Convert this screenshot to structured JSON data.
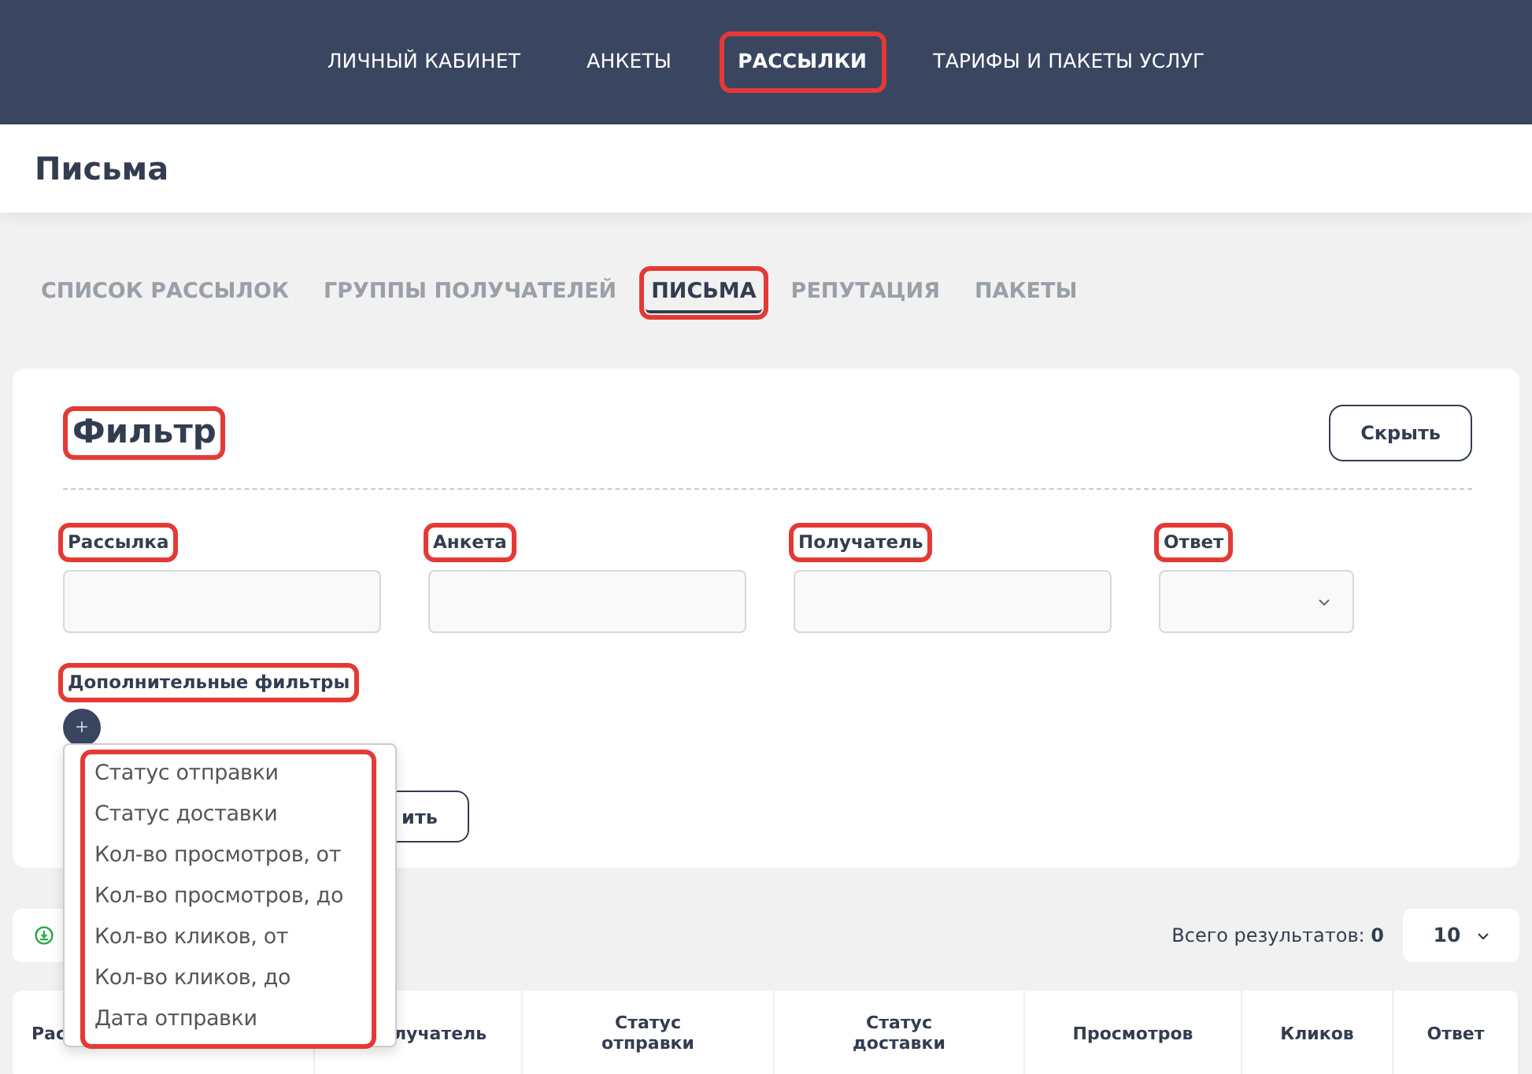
{
  "top_nav": [
    {
      "label": "ЛИЧНЫЙ КАБИНЕТ",
      "selected": false,
      "highlighted": false
    },
    {
      "label": "АНКЕТЫ",
      "selected": false,
      "highlighted": false
    },
    {
      "label": "РАССЫЛКИ",
      "selected": true,
      "highlighted": true
    },
    {
      "label": "ТАРИФЫ И ПАКЕТЫ УСЛУГ",
      "selected": false,
      "highlighted": false
    }
  ],
  "page_title": "Письма",
  "tabs": [
    {
      "label": "СПИСОК РАССЫЛОК",
      "selected": false,
      "highlighted": false
    },
    {
      "label": "ГРУППЫ ПОЛУЧАТЕЛЕЙ",
      "selected": false,
      "highlighted": false
    },
    {
      "label": "ПИСЬМА",
      "selected": true,
      "highlighted": true
    },
    {
      "label": "РЕПУТАЦИЯ",
      "selected": false,
      "highlighted": false
    },
    {
      "label": "ПАКЕТЫ",
      "selected": false,
      "highlighted": false
    }
  ],
  "filter": {
    "title": "Фильтр",
    "title_highlighted": true,
    "hide_button": "Скрыть",
    "fields": [
      {
        "label": "Рассылка",
        "kind": "text",
        "highlighted": true
      },
      {
        "label": "Анкета",
        "kind": "text",
        "highlighted": true
      },
      {
        "label": "Получатель",
        "kind": "text",
        "highlighted": true
      },
      {
        "label": "Ответ",
        "kind": "select",
        "highlighted": true
      }
    ],
    "extra_label": "Дополнительные фильтры",
    "extra_highlighted": true,
    "add_button": "+",
    "second_button": "ить",
    "dropdown": {
      "highlighted": true,
      "items": [
        "Статус отправки",
        "Статус доставки",
        "Кол-во просмотров, от",
        "Кол-во просмотров, до",
        "Кол-во кликов, от",
        "Кол-во кликов, до",
        "Дата отправки"
      ]
    }
  },
  "results": {
    "total_label": "Всего результатов:",
    "total": "0",
    "page_size": "10"
  },
  "table": {
    "columns": [
      "Рас",
      "лучатель",
      "Статус отправки",
      "Статус доставки",
      "Просмотров",
      "Кликов",
      "Ответ"
    ]
  }
}
